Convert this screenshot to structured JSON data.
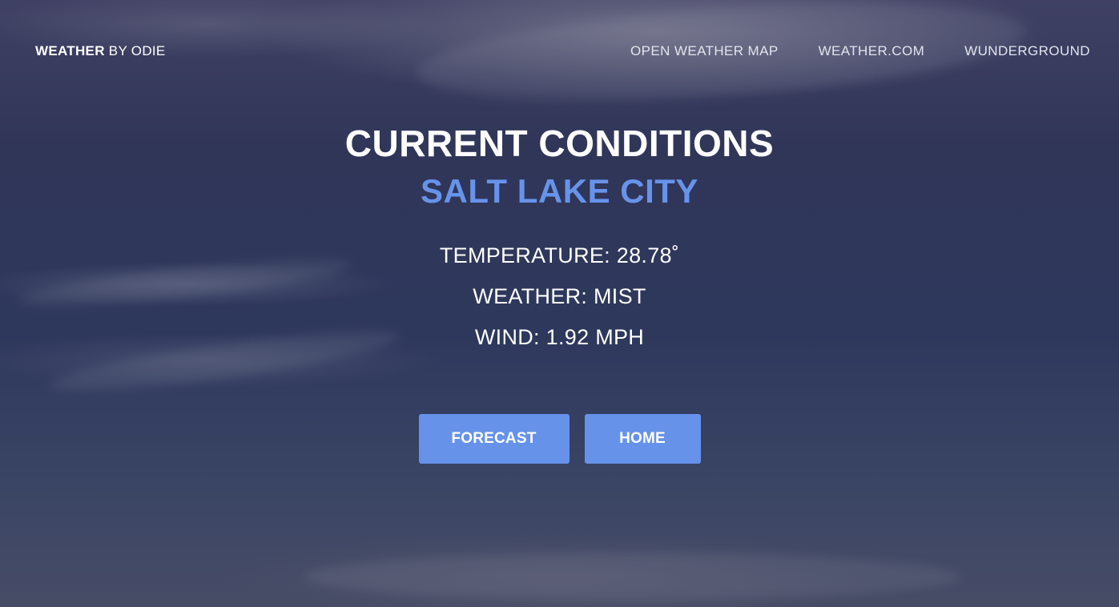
{
  "navbar": {
    "brand_strong": "WEATHER",
    "brand_light": " BY ODIE",
    "links": [
      "OPEN WEATHER MAP",
      "WEATHER.COM",
      "WUNDERGROUND"
    ]
  },
  "main": {
    "heading": "CURRENT CONDITIONS",
    "city": "SALT LAKE CITY",
    "temperature": "TEMPERATURE: 28.78˚",
    "weather": "WEATHER: MIST",
    "wind": "WIND: 1.92 MPH"
  },
  "buttons": {
    "forecast": "FORECAST",
    "home": "HOME"
  },
  "colors": {
    "accent": "#6692e9",
    "city_text": "#6793ea",
    "text": "#ffffff"
  }
}
